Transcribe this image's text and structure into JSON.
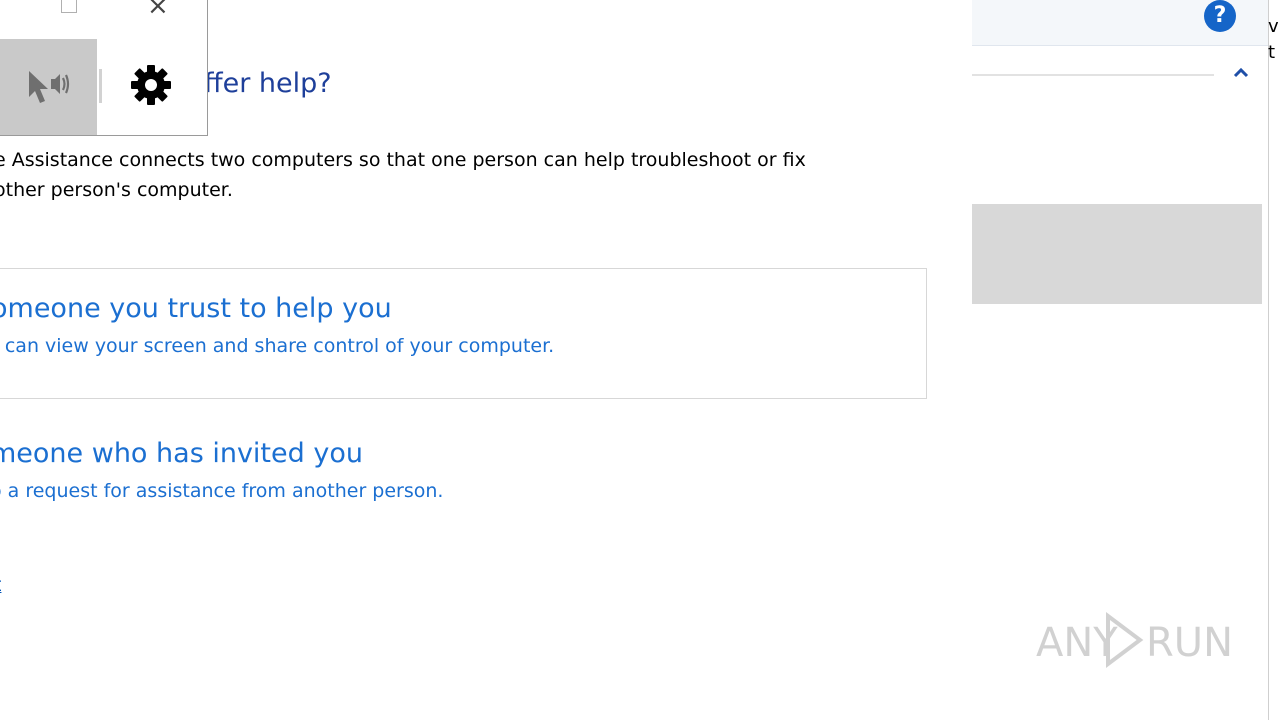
{
  "main": {
    "heading": "ffer help?",
    "intro_line1": "e Assistance connects two computers so that one person can help troubleshoot or fix",
    "intro_line2": "other person's computer.",
    "option1": {
      "title": "omeone you trust to help you",
      "desc": "r can view your screen and share control of your computer."
    },
    "option2": {
      "title": "meone who has invited you",
      "desc": "o a request for assistance from another person."
    },
    "privacy_link": "t"
  },
  "popup": {
    "close_glyph": "×",
    "icons": [
      "maximize-icon",
      "close-icon",
      "pointer-voice-icon",
      "gear-icon"
    ]
  },
  "right_pane": {
    "help_glyph": "?",
    "edge_text": "v\nt"
  },
  "watermark": {
    "text": "ANY RUN"
  },
  "colors": {
    "heading": "#1e3f9a",
    "link_blue": "#1b6fd1",
    "help_icon": "#1565c8",
    "gray_panel": "#d8d8d8"
  }
}
